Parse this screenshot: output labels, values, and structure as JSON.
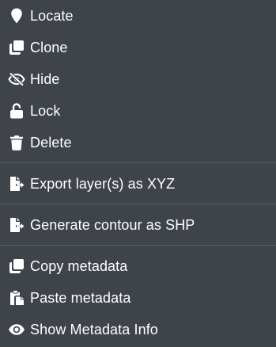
{
  "menu": {
    "items": [
      {
        "id": "locate",
        "label": "Locate",
        "icon": "map-marker-icon"
      },
      {
        "id": "clone",
        "label": "Clone",
        "icon": "clone-icon"
      },
      {
        "id": "hide",
        "label": "Hide",
        "icon": "eye-slash-icon"
      },
      {
        "id": "lock",
        "label": "Lock",
        "icon": "unlock-icon"
      },
      {
        "id": "delete",
        "label": "Delete",
        "icon": "trash-icon"
      },
      {
        "id": "export",
        "label": "Export layer(s) as XYZ",
        "icon": "file-export-icon"
      },
      {
        "id": "contour",
        "label": "Generate contour as SHP",
        "icon": "file-export-icon"
      },
      {
        "id": "copy-metadata",
        "label": "Copy metadata",
        "icon": "copy-icon"
      },
      {
        "id": "paste-metadata",
        "label": "Paste metadata",
        "icon": "paste-icon"
      },
      {
        "id": "show-metadata",
        "label": "Show Metadata Info",
        "icon": "eye-icon"
      }
    ]
  },
  "colors": {
    "background": "#3e444a",
    "text": "#ffffff",
    "divider": "#5b6167"
  }
}
